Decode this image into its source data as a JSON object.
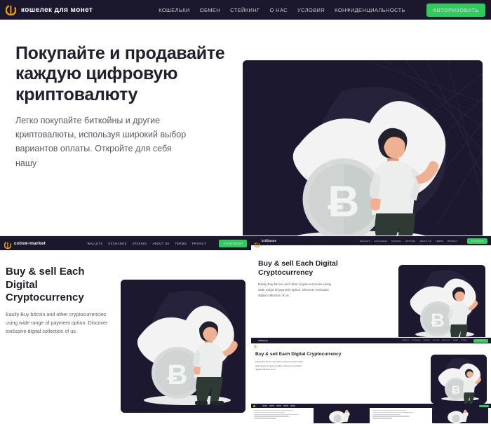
{
  "page": {
    "background_color": "#ffffff",
    "accent_green": "#2ecc5a",
    "dark_navy": "#1c1830",
    "navbar_color": "#1b172c",
    "logo_gold": "#e8a020"
  },
  "panel_ru": {
    "brand": {
      "name": "кошелек для монет",
      "icon": "coin-c-icon"
    },
    "nav": [
      {
        "label": "КОШЕЛЬКИ"
      },
      {
        "label": "ОБМЕН"
      },
      {
        "label": "СТЕЙКИНГ"
      },
      {
        "label": "О НАС"
      },
      {
        "label": "УСЛОВИЯ"
      },
      {
        "label": "КОНФИДЕНЦИАЛЬНОСТЬ"
      }
    ],
    "auth_button": "АВТОРИЗОВАТЬ",
    "hero": {
      "title": "Покупайте и продавайте каждую цифровую криптовалюту",
      "subtitle": "Легко покупайте биткойны и другие криптовалюты, используя широкий выбор вариантов оплаты. Откройте для себя нашу"
    }
  },
  "panel_en": {
    "brand": {
      "name": "coinw-market",
      "icon": "coin-c-icon"
    },
    "nav": [
      {
        "label": "WALLETS"
      },
      {
        "label": "EXCHANGE"
      },
      {
        "label": "STAKING"
      },
      {
        "label": "ABOUT US"
      },
      {
        "label": "TERMS"
      },
      {
        "label": "PRIVACY"
      }
    ],
    "auth_button": "AUTHORIZE",
    "hero": {
      "title": "Buy & sell Each Digital Cryptocurrency",
      "subtitle": "Easily Buy bitcoin and other cryptocurrencies using wide range of payment option. Discover exclusive digital collection of us."
    }
  },
  "panel_mid": {
    "brand": {
      "name": "brilliance",
      "icon": "coin-c-icon"
    },
    "nav": [
      {
        "label": "WALLETS"
      },
      {
        "label": "EXCHANGE"
      },
      {
        "label": "STAKING"
      },
      {
        "label": "OPTIONS"
      },
      {
        "label": "ABOUT US"
      },
      {
        "label": "TERMS"
      },
      {
        "label": "PRIVACY"
      }
    ],
    "auth_button": "AUTHORIZE",
    "hero": {
      "title": "Buy & sell Each Digital Cryptocurrency",
      "subtitle": "Easily Buy bitcoin and other cryptocurrencies using wide range of payment option. Discover exclusive digital collection of us."
    }
  },
  "panel_small": {
    "brand": {
      "name": "brilliance",
      "icon": "coin-c-icon"
    },
    "nav": [
      {
        "label": "WALLETS"
      },
      {
        "label": "EXCHANGE"
      },
      {
        "label": "STAKING"
      },
      {
        "label": "OPTIONS"
      },
      {
        "label": "ABOUT US"
      },
      {
        "label": "TERMS"
      },
      {
        "label": "PRIVACY"
      }
    ],
    "auth_button": "AUTHORIZE",
    "hero": {
      "title": "Buy & sell Each Digital Cryptocurrency",
      "subtitle": "Easily Buy bitcoin and other cryptocurrencies using wide range of payment option. Discover exclusive digital collection of us."
    }
  },
  "illustration": {
    "name": "bitcoin-coin-with-person-illustration",
    "coin_symbol": "Ƀ"
  }
}
